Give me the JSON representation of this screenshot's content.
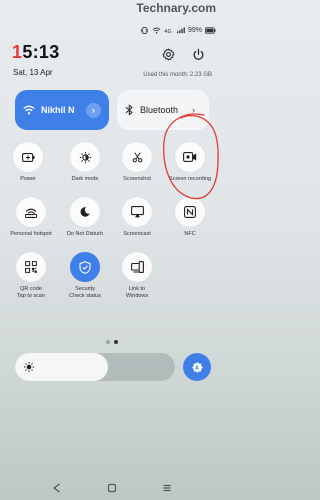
{
  "watermark": "Technary.com",
  "status_bar": {
    "battery": "99%",
    "icons": [
      "vibrate-icon",
      "wifi-icon",
      "volte-icon",
      "signal-icon",
      "battery-icon"
    ]
  },
  "header": {
    "time_first": "1",
    "time_rest": "5:13",
    "date": "Sat, 13 Apr",
    "usage_text": "Used this month: 2.23 GB"
  },
  "big_tiles": {
    "wifi": {
      "label": "Nikhil N",
      "active": true
    },
    "bluetooth": {
      "label": "Bluetooth",
      "active": false
    }
  },
  "toggles": {
    "row1": [
      {
        "label": "Power",
        "icon": "battery-saver-icon"
      },
      {
        "label": "Dark mode",
        "icon": "dark-mode-icon"
      },
      {
        "label": "Screenshot",
        "icon": "screenshot-icon"
      },
      {
        "label": "Screen recording",
        "icon": "screen-recording-icon"
      }
    ],
    "row2": [
      {
        "label": "Personal hotspot",
        "icon": "hotspot-icon"
      },
      {
        "label": "Do Not Disturb",
        "icon": "moon-icon"
      },
      {
        "label": "Screencast",
        "icon": "screencast-icon"
      },
      {
        "label": "NFC",
        "icon": "nfc-icon"
      }
    ],
    "row3": [
      {
        "label": "QR code",
        "sublabel": "Tap to scan",
        "icon": "qr-code-icon"
      },
      {
        "label": "Security",
        "sublabel": "Check status",
        "icon": "shield-icon",
        "active": true
      },
      {
        "label": "Link to Windows",
        "icon": "link-to-windows-icon"
      }
    ]
  },
  "pager": {
    "pages": 2,
    "current": 2
  },
  "brightness": {
    "level": 0.58
  },
  "colors": {
    "accent": "#3f7fe8",
    "annotation": "#e53935",
    "clock_highlight": "#e53935"
  }
}
